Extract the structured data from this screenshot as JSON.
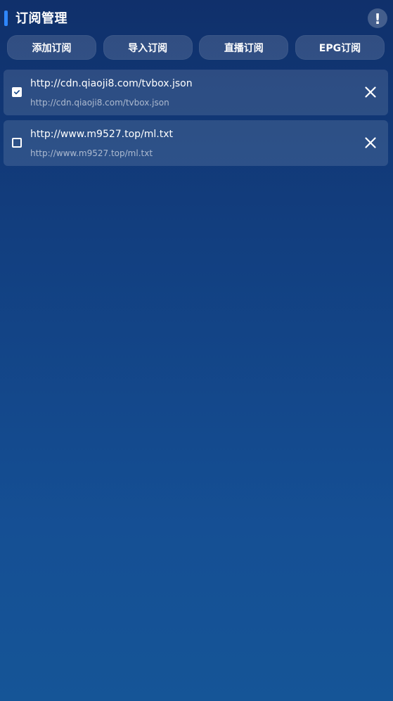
{
  "header": {
    "title": "订阅管理",
    "info_icon": "exclamation-circle-icon",
    "info_symbol": "!",
    "accent_color": "#2f87ff"
  },
  "actions": [
    {
      "label": "添加订阅"
    },
    {
      "label": "导入订阅"
    },
    {
      "label": "直播订阅"
    },
    {
      "label": "EPG订阅"
    }
  ],
  "subscriptions": [
    {
      "checked": true,
      "url": "http://cdn.qiaoji8.com/tvbox.json",
      "subtitle": "http://cdn.qiaoji8.com/tvbox.json"
    },
    {
      "checked": false,
      "url": "http://www.m9527.top/ml.txt",
      "subtitle": "http://www.m9527.top/ml.txt"
    }
  ],
  "icons": {
    "checkbox_checked": "checkbox-checked-icon",
    "checkbox_unchecked": "checkbox-unchecked-icon",
    "delete": "close-icon"
  }
}
